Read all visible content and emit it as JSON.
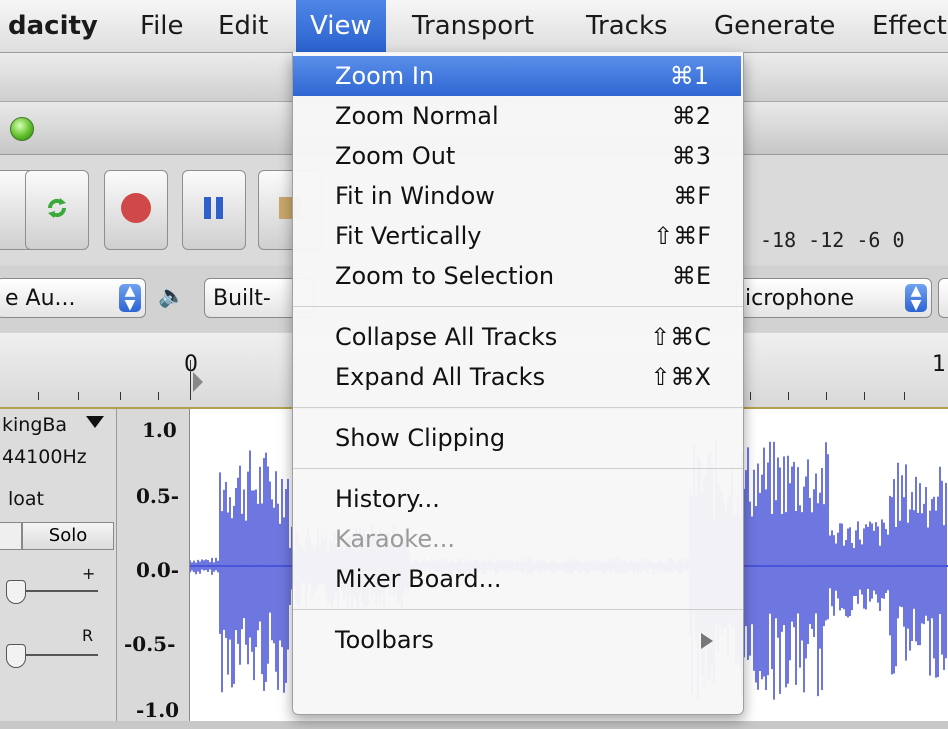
{
  "menubar": {
    "app": "dacity",
    "items": [
      "File",
      "Edit",
      "View",
      "Transport",
      "Tracks",
      "Generate",
      "Effect"
    ]
  },
  "meter": {
    "labels": "-18 -12 -6 0"
  },
  "device": {
    "host": "e Au...",
    "output": "Built-",
    "input": "icrophone"
  },
  "ruler": {
    "zero": "0",
    "one": "1"
  },
  "track": {
    "name": "kingBa",
    "rate": "44100Hz",
    "format": "loat",
    "solo": "Solo",
    "gain_plus": "+",
    "pan_r": "R",
    "scale": [
      "1.0",
      "0.5-",
      "0.0-",
      "-0.5-",
      "-1.0"
    ]
  },
  "view_menu": {
    "groups": [
      [
        {
          "label": "Zoom In",
          "shortcut": "⌘1",
          "highlighted": true
        },
        {
          "label": "Zoom Normal",
          "shortcut": "⌘2"
        },
        {
          "label": "Zoom Out",
          "shortcut": "⌘3"
        },
        {
          "label": "Fit in Window",
          "shortcut": "⌘F"
        },
        {
          "label": "Fit Vertically",
          "shortcut": "⇧⌘F"
        },
        {
          "label": "Zoom to Selection",
          "shortcut": "⌘E"
        }
      ],
      [
        {
          "label": "Collapse All Tracks",
          "shortcut": "⇧⌘C"
        },
        {
          "label": "Expand All Tracks",
          "shortcut": "⇧⌘X"
        }
      ],
      [
        {
          "label": "Show Clipping",
          "shortcut": ""
        }
      ],
      [
        {
          "label": "History...",
          "shortcut": ""
        },
        {
          "label": "Karaoke...",
          "shortcut": "",
          "disabled": true
        },
        {
          "label": "Mixer Board...",
          "shortcut": ""
        }
      ],
      [
        {
          "label": "Toolbars",
          "shortcut": "",
          "submenu": true
        }
      ]
    ]
  },
  "colors": {
    "accent": "#2f66d2",
    "waveform": "#4a55d8"
  }
}
